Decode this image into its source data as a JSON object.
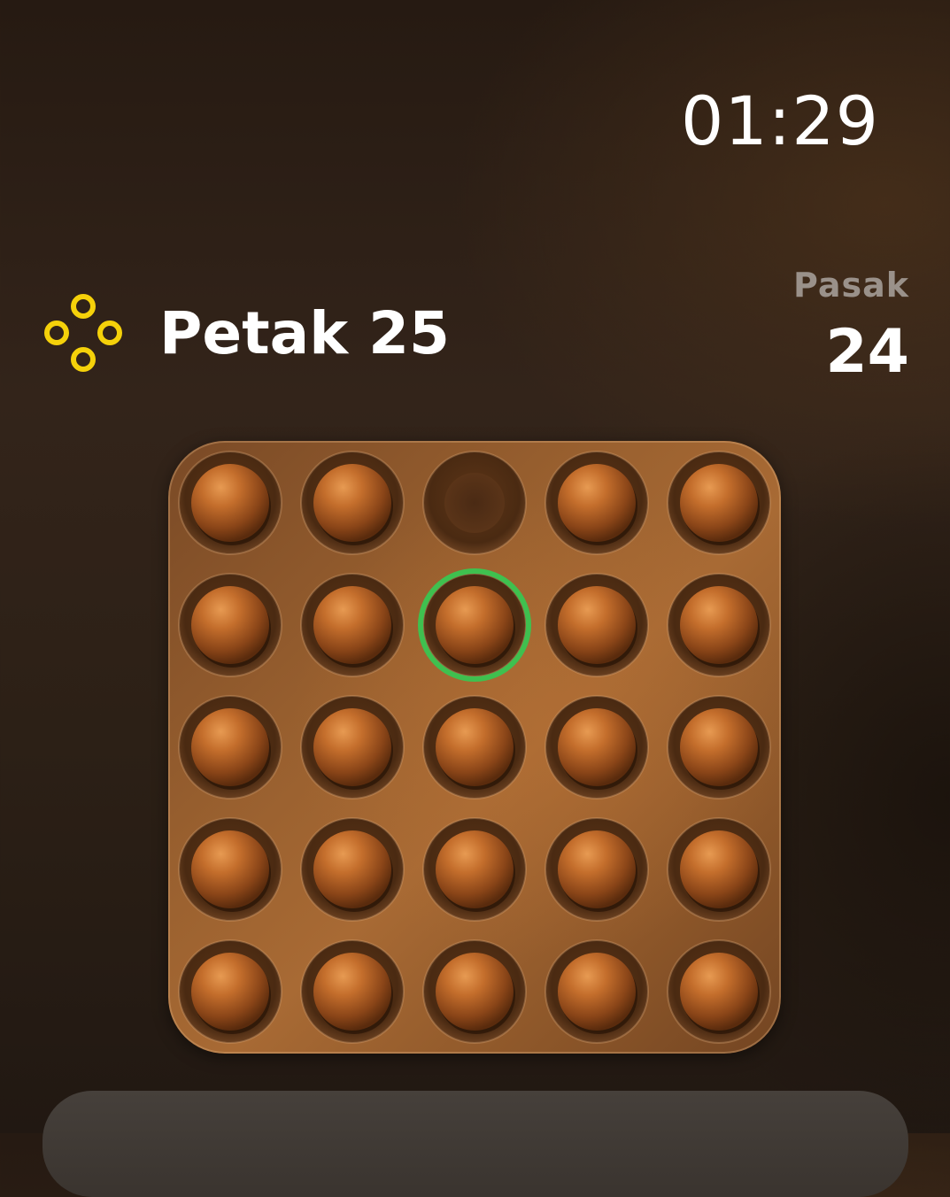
{
  "status": {
    "time": "01:29"
  },
  "puzzle": {
    "icon": "peg-cluster-icon",
    "title": "Petak 25",
    "icon_color": "#f5d10a"
  },
  "pegs": {
    "label": "Pasak",
    "count": "24"
  },
  "board": {
    "rows": 5,
    "cols": 5,
    "cells": [
      [
        "peg",
        "peg",
        "empty",
        "peg",
        "peg"
      ],
      [
        "peg",
        "peg",
        "selected",
        "peg",
        "peg"
      ],
      [
        "peg",
        "peg",
        "peg",
        "peg",
        "peg"
      ],
      [
        "peg",
        "peg",
        "peg",
        "peg",
        "peg"
      ],
      [
        "peg",
        "peg",
        "peg",
        "peg",
        "peg"
      ]
    ],
    "selection_color": "#3fc04f"
  }
}
